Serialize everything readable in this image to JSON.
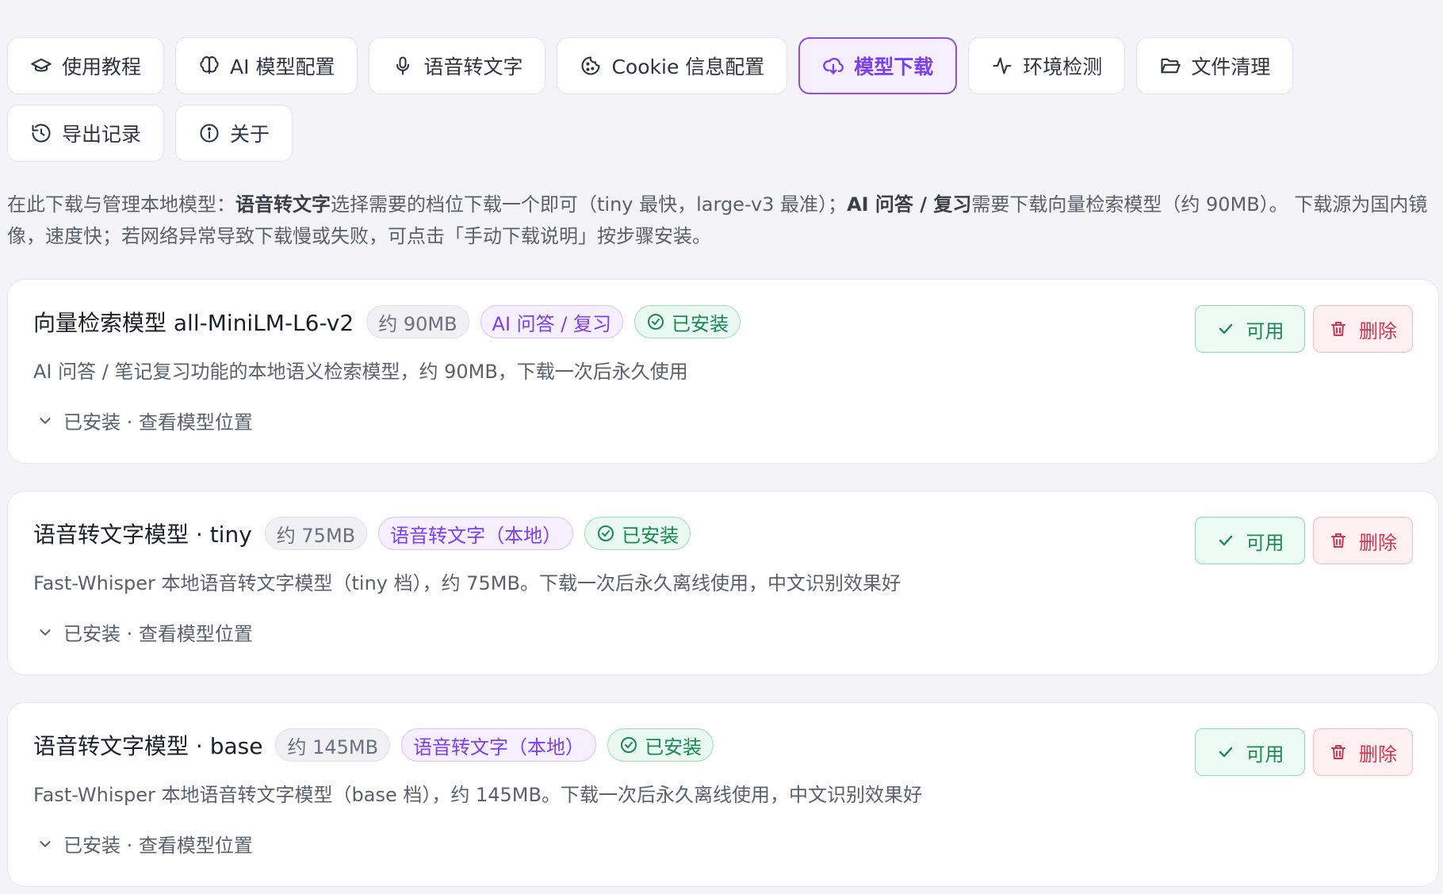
{
  "tabs": [
    {
      "label": "使用教程",
      "icon": "graduation-cap-icon",
      "active": false
    },
    {
      "label": "AI 模型配置",
      "icon": "brain-icon",
      "active": false
    },
    {
      "label": "语音转文字",
      "icon": "microphone-icon",
      "active": false
    },
    {
      "label": "Cookie 信息配置",
      "icon": "cookie-icon",
      "active": false
    },
    {
      "label": "模型下载",
      "icon": "cloud-download-icon",
      "active": true
    },
    {
      "label": "环境检测",
      "icon": "activity-icon",
      "active": false
    },
    {
      "label": "文件清理",
      "icon": "folder-open-icon",
      "active": false
    },
    {
      "label": "导出记录",
      "icon": "history-icon",
      "active": false
    },
    {
      "label": "关于",
      "icon": "info-icon",
      "active": false
    }
  ],
  "intro": {
    "p1": "在此下载与管理本地模型：",
    "b1": "语音转文字",
    "p2": "选择需要的档位下载一个即可（tiny 最快，large-v3 最准）；",
    "b2": "AI 问答 / 复习",
    "p3": "需要下载向量检索模型（约 90MB）。 下载源为国内镜像，速度快；若网络异常导致下载慢或失败，可点击「手动下载说明」按步骤安装。"
  },
  "models": [
    {
      "title": "向量检索模型 all-MiniLM-L6-v2",
      "size": "约 90MB",
      "tag": "AI 问答 / 复习",
      "status": "已安装",
      "desc": "AI 问答 / 笔记复习功能的本地语义检索模型，约 90MB，下载一次后永久使用",
      "footer": "已安装 · 查看模型位置",
      "available_label": "可用",
      "delete_label": "删除"
    },
    {
      "title": "语音转文字模型 · tiny",
      "size": "约 75MB",
      "tag": "语音转文字（本地）",
      "status": "已安装",
      "desc": "Fast-Whisper 本地语音转文字模型（tiny 档），约 75MB。下载一次后永久离线使用，中文识别效果好",
      "footer": "已安装 · 查看模型位置",
      "available_label": "可用",
      "delete_label": "删除"
    },
    {
      "title": "语音转文字模型 · base",
      "size": "约 145MB",
      "tag": "语音转文字（本地）",
      "status": "已安装",
      "desc": "Fast-Whisper 本地语音转文字模型（base 档），约 145MB。下载一次后永久离线使用，中文识别效果好",
      "footer": "已安装 · 查看模型位置",
      "available_label": "可用",
      "delete_label": "删除"
    }
  ],
  "colors": {
    "accent": "#7a3ff2",
    "success": "#178a55",
    "danger": "#d63350",
    "background": "#f4f3f8"
  }
}
